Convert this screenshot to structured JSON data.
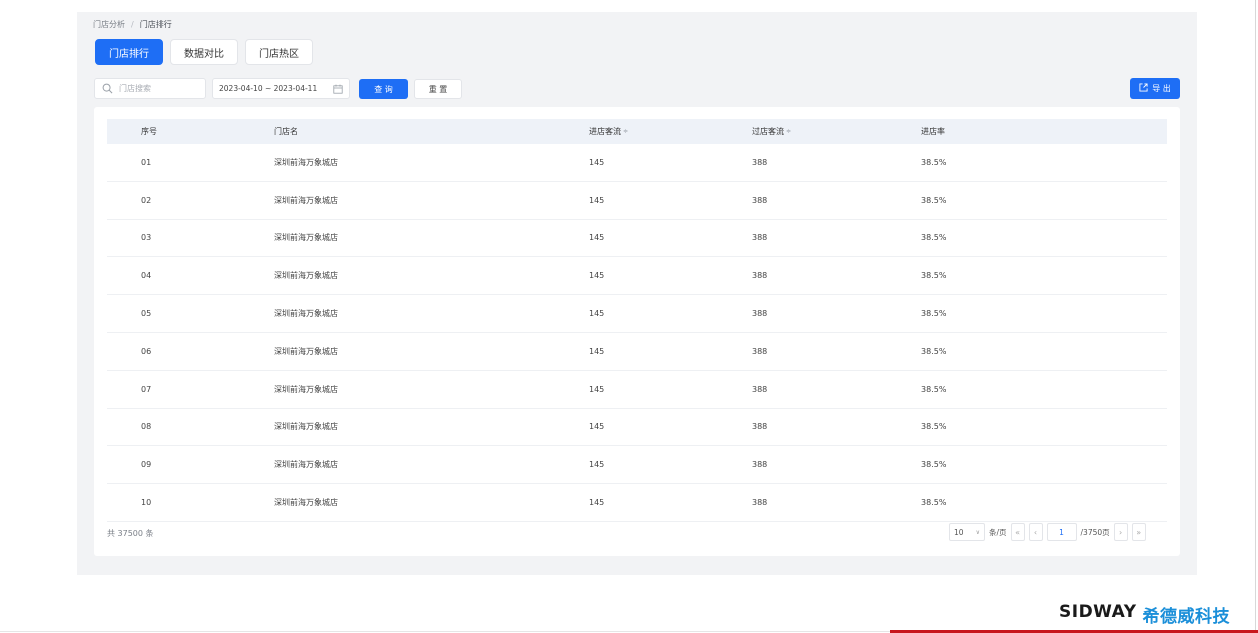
{
  "breadcrumb": {
    "parent": "门店分析",
    "separator": "/",
    "current": "门店排行"
  },
  "tabs": [
    {
      "label": "门店排行",
      "active": true
    },
    {
      "label": "数据对比",
      "active": false
    },
    {
      "label": "门店热区",
      "active": false
    }
  ],
  "search": {
    "placeholder": "门店搜索",
    "value": ""
  },
  "date_range": {
    "value": "2023-04-10 ~ 2023-04-11"
  },
  "buttons": {
    "query": "查 询",
    "reset": "重 置",
    "export": "导 出"
  },
  "table": {
    "columns": [
      "序号",
      "门店名",
      "进店客流",
      "过店客流",
      "进店率"
    ],
    "sort_icon": "≑",
    "rows": [
      [
        "01",
        "深圳前海万象城店",
        "145",
        "388",
        "38.5%"
      ],
      [
        "02",
        "深圳前海万象城店",
        "145",
        "388",
        "38.5%"
      ],
      [
        "03",
        "深圳前海万象城店",
        "145",
        "388",
        "38.5%"
      ],
      [
        "04",
        "深圳前海万象城店",
        "145",
        "388",
        "38.5%"
      ],
      [
        "05",
        "深圳前海万象城店",
        "145",
        "388",
        "38.5%"
      ],
      [
        "06",
        "深圳前海万象城店",
        "145",
        "388",
        "38.5%"
      ],
      [
        "07",
        "深圳前海万象城店",
        "145",
        "388",
        "38.5%"
      ],
      [
        "08",
        "深圳前海万象城店",
        "145",
        "388",
        "38.5%"
      ],
      [
        "09",
        "深圳前海万象城店",
        "145",
        "388",
        "38.5%"
      ],
      [
        "10",
        "深圳前海万象城店",
        "145",
        "388",
        "38.5%"
      ]
    ]
  },
  "footer": {
    "total": "共 37500 条",
    "page_size": "10",
    "page_size_unit": "条/页",
    "current_page": "1",
    "total_pages": "/3750页"
  },
  "brand": {
    "en": "SIDWAY",
    "cn": "希德威科技"
  },
  "colors": {
    "primary": "#1e6ef5",
    "brand_blue": "#1b8fd9",
    "brand_red": "#c8171e"
  }
}
